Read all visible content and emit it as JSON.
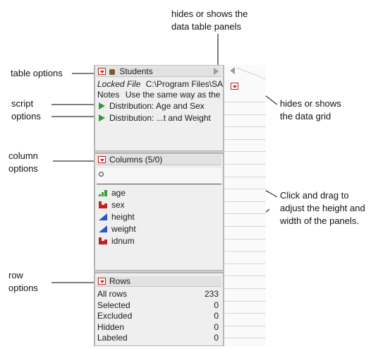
{
  "annotations": {
    "hides_shows_panels": [
      "hides or shows the",
      "data table panels"
    ],
    "table_options": "table options",
    "script_options": [
      "script",
      "options"
    ],
    "hides_shows_grid": [
      "hides or shows",
      "the data grid"
    ],
    "column_options": [
      "column",
      "options"
    ],
    "click_drag": [
      "Click and drag to",
      "adjust the height and",
      "width of the panels."
    ],
    "row_options": [
      "row",
      "options"
    ]
  },
  "table_panel": {
    "title": "Students",
    "locked_label": "Locked File",
    "locked_path": "C:\\Program Files\\SA",
    "notes_label": "Notes",
    "notes_value": "Use the same way as the",
    "scripts": [
      "Distribution: Age and Sex",
      "Distribution: ...t and Weight"
    ]
  },
  "columns_panel": {
    "title": "Columns (5/0)",
    "search_placeholder": "",
    "items": [
      {
        "name": "age",
        "icon": "ordinal-icon",
        "color": "#3a9a3a"
      },
      {
        "name": "sex",
        "icon": "nominal-icon",
        "color": "#c42020"
      },
      {
        "name": "height",
        "icon": "continuous-icon",
        "color": "#2a55c8"
      },
      {
        "name": "weight",
        "icon": "continuous-icon",
        "color": "#2a55c8"
      },
      {
        "name": "idnum",
        "icon": "nominal-icon",
        "color": "#c42020"
      }
    ]
  },
  "rows_panel": {
    "title": "Rows",
    "items": [
      {
        "label": "All rows",
        "value": "233"
      },
      {
        "label": "Selected",
        "value": "0"
      },
      {
        "label": "Excluded",
        "value": "0"
      },
      {
        "label": "Hidden",
        "value": "0"
      },
      {
        "label": "Labeled",
        "value": "0"
      }
    ]
  },
  "colors": {
    "accent_red": "#c42020",
    "script_green": "#2e9a3a"
  }
}
